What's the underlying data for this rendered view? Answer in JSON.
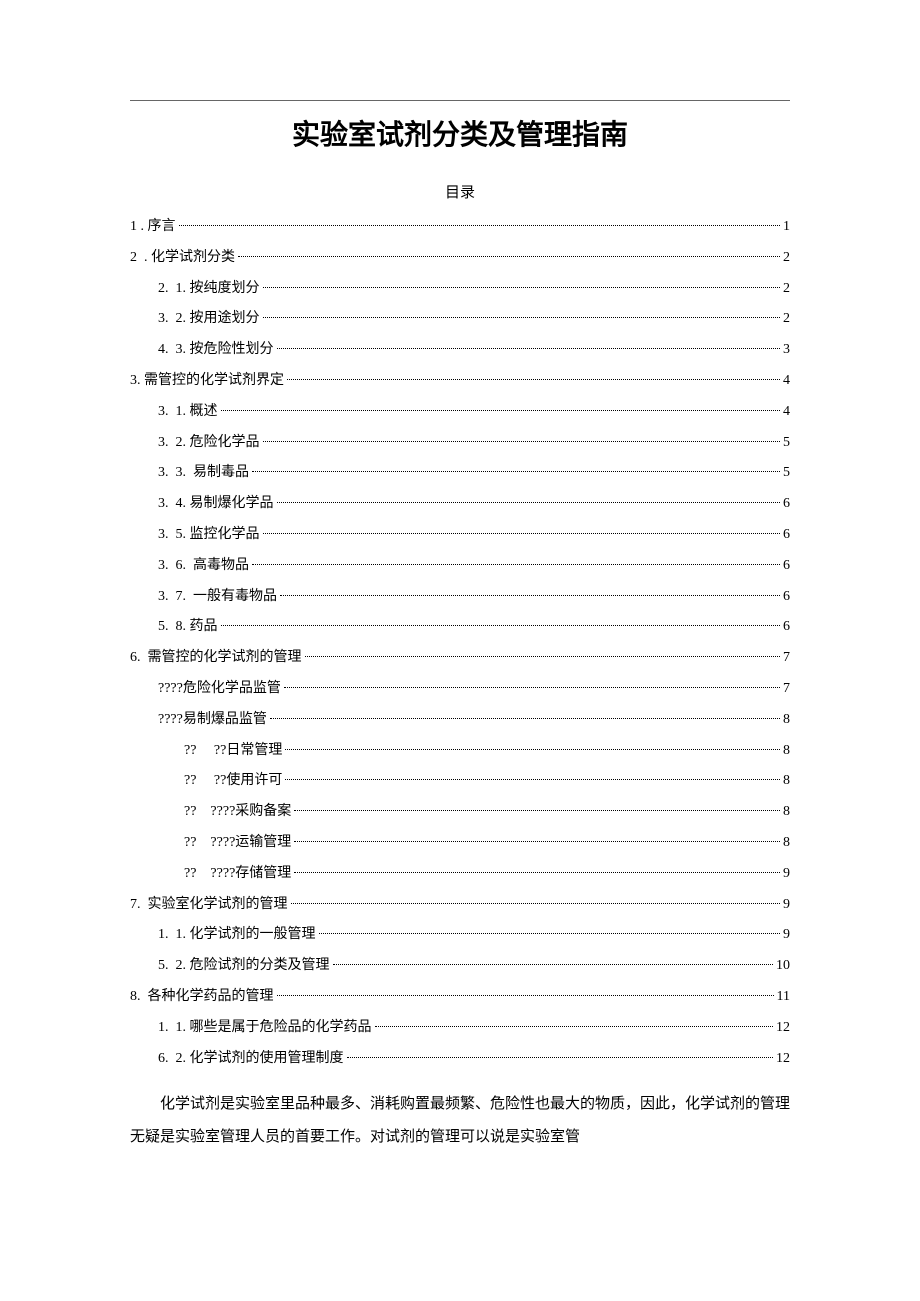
{
  "title": "实验室试剂分类及管理指南",
  "subtitle": "目录",
  "toc": [
    {
      "indent": 0,
      "label": "1 . 序言",
      "page": "1"
    },
    {
      "indent": 0,
      "label": "2  . 化学试剂分类",
      "page": "2"
    },
    {
      "indent": 1,
      "label": "2.  1. 按纯度划分",
      "page": "2"
    },
    {
      "indent": 1,
      "label": "3.  2. 按用途划分",
      "page": "2"
    },
    {
      "indent": 1,
      "label": "4.  3. 按危险性划分",
      "page": "3"
    },
    {
      "indent": 0,
      "label": "3. 需管控的化学试剂界定",
      "page": "4"
    },
    {
      "indent": 1,
      "label": "3.  1. 概述",
      "page": "4"
    },
    {
      "indent": 1,
      "label": "3.  2. 危险化学品",
      "page": "5"
    },
    {
      "indent": 1,
      "label": "3.  3.  易制毒品",
      "page": "5"
    },
    {
      "indent": 1,
      "label": "3.  4. 易制爆化学品",
      "page": "6"
    },
    {
      "indent": 1,
      "label": "3.  5. 监控化学品",
      "page": "6"
    },
    {
      "indent": 1,
      "label": "3.  6.  高毒物品",
      "page": "6"
    },
    {
      "indent": 1,
      "label": "3.  7.  一般有毒物品",
      "page": "6"
    },
    {
      "indent": 1,
      "label": "5.  8. 药品",
      "page": "6"
    },
    {
      "indent": 0,
      "label": "6.  需管控的化学试剂的管理",
      "page": "7"
    },
    {
      "indent": 1,
      "label": "????危险化学品监管",
      "page": "7"
    },
    {
      "indent": 1,
      "label": "????易制爆品监管",
      "page": "8"
    },
    {
      "indent": 2,
      "label": "??     ??日常管理",
      "page": "8"
    },
    {
      "indent": 2,
      "label": "??     ??使用许可",
      "page": "8"
    },
    {
      "indent": 2,
      "label": "??    ????采购备案",
      "page": "8"
    },
    {
      "indent": 2,
      "label": "??    ????运输管理",
      "page": "8"
    },
    {
      "indent": 2,
      "label": "??    ????存储管理",
      "page": "9"
    },
    {
      "indent": 0,
      "label": "7.  实验室化学试剂的管理",
      "page": "9"
    },
    {
      "indent": 1,
      "label": "1.  1. 化学试剂的一般管理",
      "page": "9"
    },
    {
      "indent": 1,
      "label": "5.  2. 危险试剂的分类及管理",
      "page": "10"
    },
    {
      "indent": 0,
      "label": "8.  各种化学药品的管理",
      "page": "11"
    },
    {
      "indent": 1,
      "label": "1.  1. 哪些是属于危险品的化学药品",
      "page": "12"
    },
    {
      "indent": 1,
      "label": "6.  2. 化学试剂的使用管理制度",
      "page": "12"
    }
  ],
  "body": {
    "p1": "化学试剂是实验室里品种最多、消耗购置最频繁、危险性也最大的物质，因此，化学试剂的管理无疑是实验室管理人员的首要工作。对试剂的管理可以说是实验室管"
  }
}
